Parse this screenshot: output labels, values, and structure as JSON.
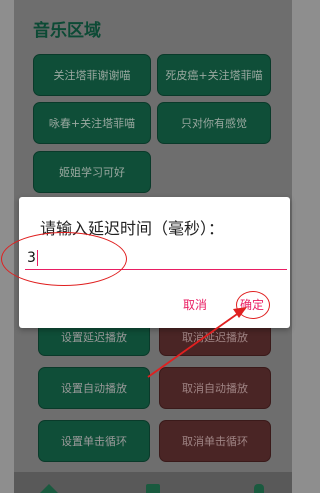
{
  "section": {
    "title": "音乐区域"
  },
  "songs": [
    "关注塔菲谢谢喵",
    "死皮癌+关注塔菲喵",
    "咏春+关注塔菲喵",
    "只对你有感觉",
    "姬姐学习可好"
  ],
  "controls": {
    "set_delay": "设置延迟播放",
    "cancel_delay": "取消延迟播放",
    "set_auto": "设置自动播放",
    "cancel_auto": "取消自动播放",
    "set_loop": "设置单击循环",
    "cancel_loop": "取消单击循环"
  },
  "dialog": {
    "title": "请输入延迟时间（毫秒）：",
    "input_value": "3",
    "cancel": "取消",
    "confirm": "确定"
  },
  "colors": {
    "accent": "#e91e63",
    "annotation": "#e02020"
  }
}
